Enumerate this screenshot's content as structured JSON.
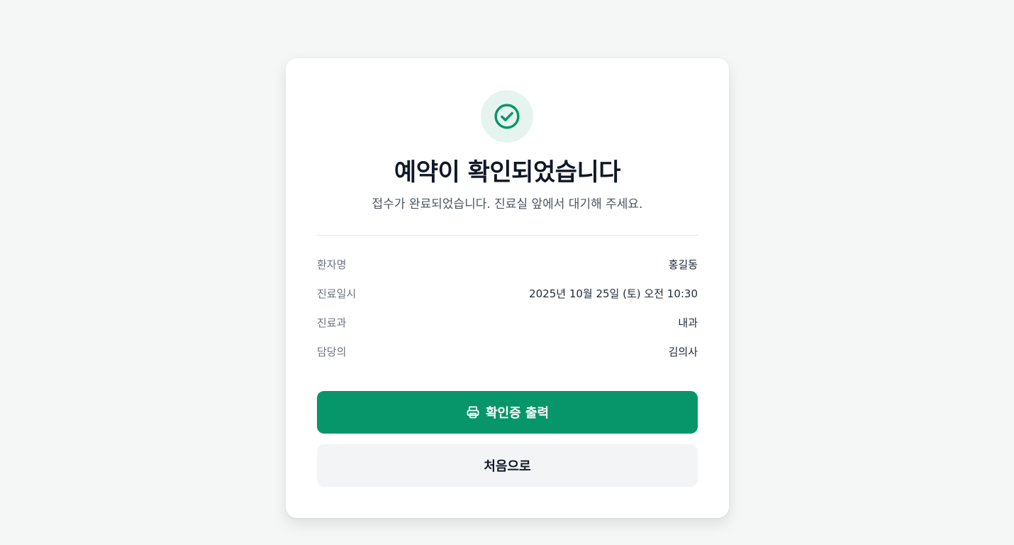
{
  "confirmation": {
    "title": "예약이 확인되었습니다",
    "subtitle": "접수가 완료되었습니다. 진료실 앞에서 대기해 주세요."
  },
  "details": [
    {
      "label": "환자명",
      "value": "홍길동"
    },
    {
      "label": "진료일시",
      "value": "2025년 10월 25일 (토) 오전 10:30"
    },
    {
      "label": "진료과",
      "value": "내과"
    },
    {
      "label": "담당의",
      "value": "김의사"
    }
  ],
  "buttons": {
    "print_label": "확인증 출력",
    "home_label": "처음으로"
  },
  "icons": {
    "status": "check-circle-icon",
    "print": "printer-icon"
  },
  "colors": {
    "accent": "#079669",
    "accent_light": "#e6f4ef",
    "background": "#f5f7f6"
  }
}
